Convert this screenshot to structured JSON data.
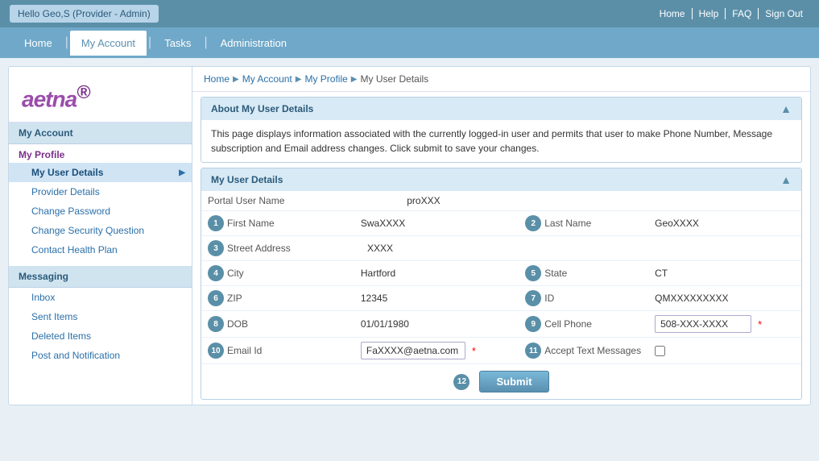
{
  "topBar": {
    "greeting": "Hello Geo,S (Provider - Admin)",
    "links": [
      "Home",
      "Help",
      "FAQ",
      "Sign Out"
    ]
  },
  "navBar": {
    "items": [
      "Home",
      "My Account",
      "Tasks",
      "Administration"
    ],
    "activeItem": "My Account"
  },
  "breadcrumb": {
    "items": [
      "Home",
      "My Account",
      "My Profile",
      "My User Details"
    ]
  },
  "infoPanel": {
    "title": "About My User Details",
    "body": "This page displays information associated with the currently logged-in user and permits that user to make Phone Number, Message subscription and Email address changes. Click submit to save your changes."
  },
  "detailsPanel": {
    "title": "My User Details",
    "fields": {
      "portalUserName": {
        "label": "Portal User Name",
        "value": "proXXX"
      },
      "firstName": {
        "label": "First Name",
        "value": "SwaXXXX",
        "num": "1"
      },
      "lastName": {
        "label": "Last Name",
        "value": "GeoXXXX",
        "num": "2"
      },
      "streetAddress": {
        "label": "Street Address",
        "value": "XXXX",
        "num": "3"
      },
      "city": {
        "label": "City",
        "value": "Hartford",
        "num": "4"
      },
      "state": {
        "label": "State",
        "value": "CT",
        "num": "5"
      },
      "zip": {
        "label": "ZIP",
        "value": "12345",
        "num": "6"
      },
      "id": {
        "label": "ID",
        "value": "QMXXXXXXXXX",
        "num": "7"
      },
      "dob": {
        "label": "DOB",
        "value": "01/01/1980",
        "num": "8"
      },
      "cellPhone": {
        "label": "Cell Phone",
        "value": "508-XXX-XXXX",
        "num": "9",
        "editable": true,
        "required": true
      },
      "emailId": {
        "label": "Email Id",
        "value": "FaXXXX@aetna.com",
        "num": "10",
        "editable": true,
        "required": true
      },
      "acceptTextMessages": {
        "label": "Accept Text Messages",
        "num": "11"
      }
    },
    "submitNum": "12",
    "submitLabel": "Submit"
  },
  "sidebar": {
    "myAccountTitle": "My Account",
    "myProfileTitle": "My Profile",
    "items": [
      {
        "label": "My User Details",
        "active": true
      },
      {
        "label": "Provider Details",
        "active": false
      },
      {
        "label": "Change Password",
        "active": false
      },
      {
        "label": "Change Security Question",
        "active": false
      },
      {
        "label": "Contact Health Plan",
        "active": false
      }
    ],
    "messagingTitle": "Messaging",
    "messagingItems": [
      {
        "label": "Inbox"
      },
      {
        "label": "Sent Items"
      },
      {
        "label": "Deleted Items"
      },
      {
        "label": "Post and Notification"
      }
    ]
  },
  "logo": {
    "text1": "aetna",
    "superscript": "®"
  }
}
